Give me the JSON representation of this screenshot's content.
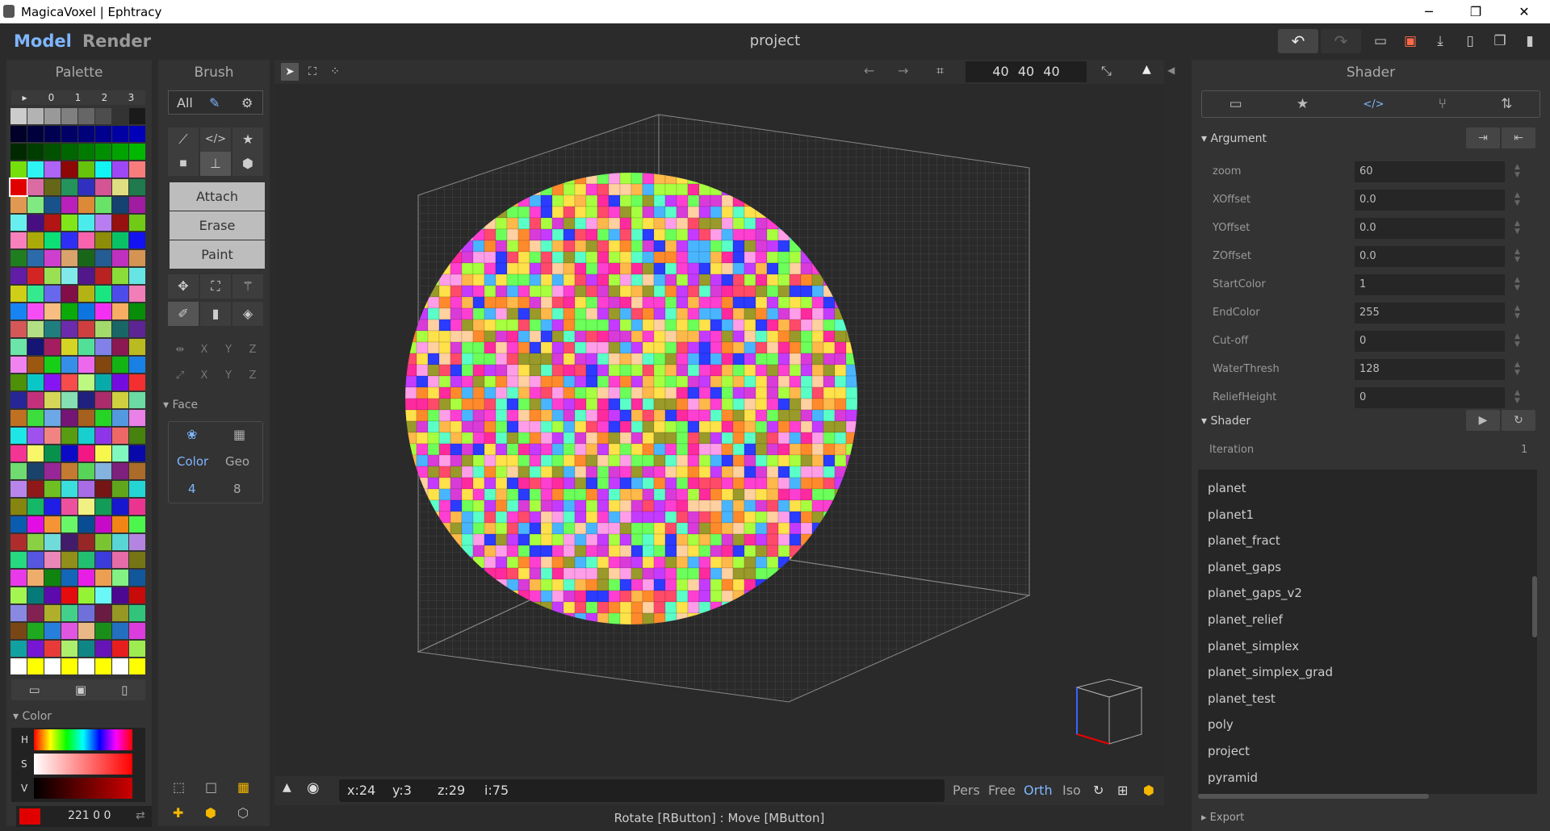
{
  "window": {
    "title": "MagicaVoxel | Ephtracy",
    "min": "─",
    "max": "❐",
    "close": "✕"
  },
  "menu": {
    "model": "Model",
    "render": "Render",
    "project": "project"
  },
  "palette": {
    "title": "Palette",
    "tabs": [
      "▸",
      "0",
      "1",
      "2",
      "3"
    ]
  },
  "color": {
    "section": "▾ Color",
    "h": "H",
    "s": "S",
    "v": "V",
    "value": "221 0 0",
    "swap": "⇄"
  },
  "brush": {
    "title": "Brush",
    "all": "All",
    "modes": [
      "Attach",
      "Erase",
      "Paint"
    ],
    "axes": [
      "X",
      "Y",
      "Z"
    ],
    "face": {
      "section": "▾ Face",
      "color_label": "Color",
      "color_count": "4",
      "geo_label": "Geo",
      "geo_count": "8"
    }
  },
  "viewport": {
    "dims": "40 40 40",
    "x": "x:24",
    "y": "y:3",
    "z": "z:29",
    "i": "i:75",
    "views": [
      "Pers",
      "Free",
      "Orth",
      "Iso"
    ],
    "status": "Rotate [RButton] : Move [MButton]"
  },
  "shader": {
    "title": "Shader",
    "argument": "▾ Argument",
    "shader_section": "▾ Shader",
    "iteration": "Iteration",
    "iteration_value": "1",
    "export": "▸ Export",
    "args": [
      {
        "name": "zoom",
        "value": "60"
      },
      {
        "name": "XOffset",
        "value": "0.0"
      },
      {
        "name": "YOffset",
        "value": "0.0"
      },
      {
        "name": "ZOffset",
        "value": "0.0"
      },
      {
        "name": "StartColor",
        "value": "1"
      },
      {
        "name": "EndColor",
        "value": "255"
      },
      {
        "name": "Cut-off",
        "value": "0"
      },
      {
        "name": "WaterThresh",
        "value": "128"
      },
      {
        "name": "ReliefHeight",
        "value": "0"
      }
    ],
    "files": [
      "planet",
      "planet1",
      "planet_fract",
      "planet_gaps",
      "planet_gaps_v2",
      "planet_relief",
      "planet_simplex",
      "planet_simplex_grad",
      "planet_test",
      "poly",
      "project",
      "pyramid"
    ]
  },
  "colors": {
    "accent": "#7fb6ff",
    "selected": "#e00000"
  }
}
